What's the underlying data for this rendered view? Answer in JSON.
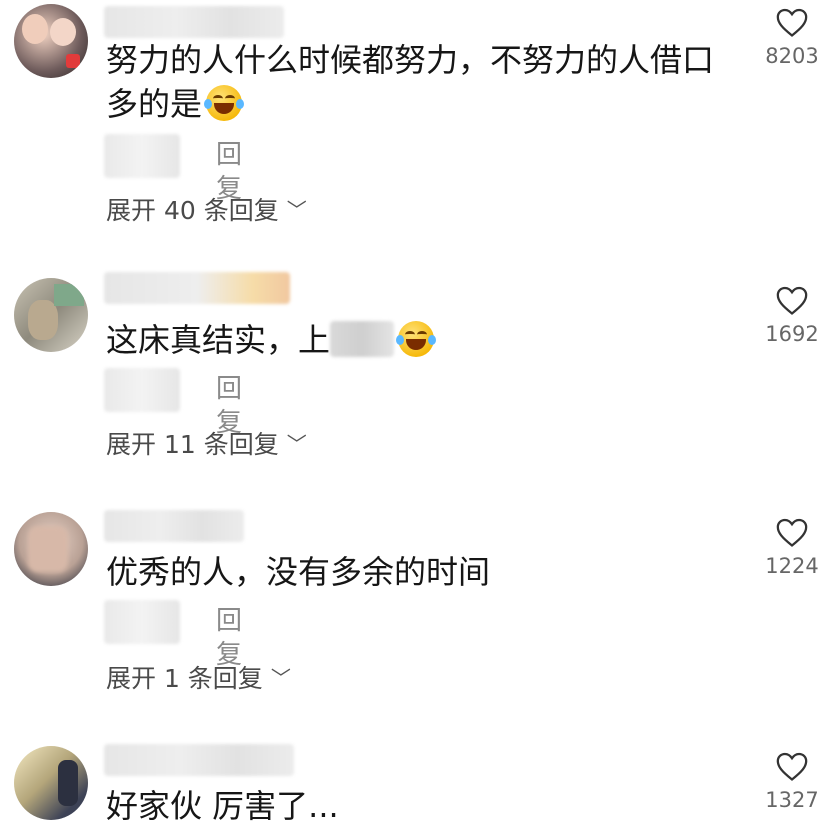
{
  "comments": [
    {
      "text": "努力的人什么时候都努力，不努力的人借口",
      "text_line2": "多的是",
      "reply_label": "回复",
      "expand": "展开 40 条回复",
      "likes": "8203",
      "emoji": "laughing-tears"
    },
    {
      "text": "这床真结实，上",
      "reply_label": "回复",
      "expand": "展开 11 条回复",
      "likes": "1692",
      "emoji": "laughing-tears"
    },
    {
      "text": "优秀的人，没有多余的时间",
      "reply_label": "回复",
      "expand": "展开 1 条回复",
      "likes": "1224"
    },
    {
      "text": "好家伙 厉害了...",
      "likes": "1327"
    }
  ],
  "colors": {
    "text": "#161616",
    "secondary": "#8a8a8a",
    "like_icon": "#333333"
  }
}
